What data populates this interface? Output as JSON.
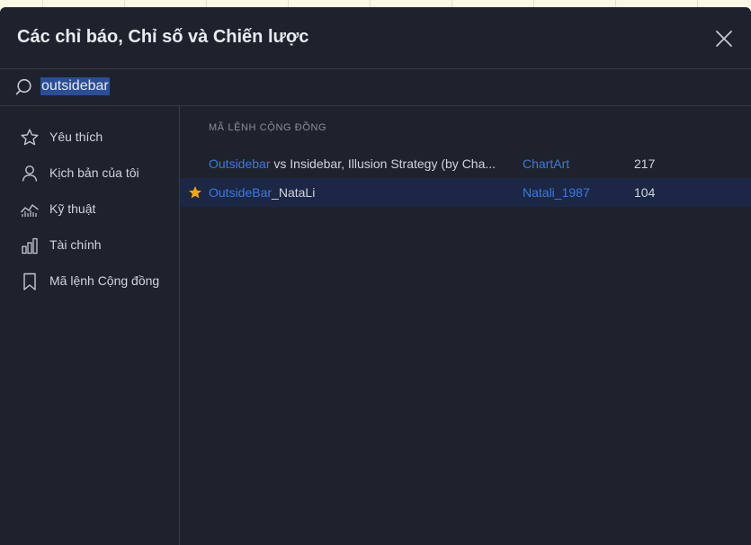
{
  "dialog": {
    "title": "Các chỉ báo, Chỉ số và Chiến lược"
  },
  "search": {
    "value": "outsidebar",
    "placeholder": "",
    "icon": "search-icon"
  },
  "sidebar": {
    "items": [
      {
        "label": "Yêu thích",
        "icon": "star-outline-icon"
      },
      {
        "label": "Kịch bản của tôi",
        "icon": "user-icon"
      },
      {
        "label": "Kỹ thuật",
        "icon": "chart-line-icon"
      },
      {
        "label": "Tài chính",
        "icon": "bar-chart-icon"
      },
      {
        "label": "Mã lệnh Cộng đồng",
        "icon": "bookmark-icon"
      }
    ]
  },
  "results": {
    "section_label": "MÃ LỆNH CỘNG ĐỒNG",
    "rows": [
      {
        "name_match": "Outsidebar",
        "name_rest": " vs Insidebar, Illusion Strategy (by Cha...",
        "author": "ChartArt",
        "count": "217",
        "favorite": false
      },
      {
        "name_match": "OutsideBar",
        "name_rest": "_NataLi",
        "author": "Natali_1987",
        "count": "104",
        "favorite": true
      }
    ]
  },
  "colors": {
    "dialog_bg": "#1e222d",
    "accent_blue": "#3d7ae0",
    "star_gold": "#f7a600",
    "row_highlight": "#1b2744",
    "selection_bg": "#2a4f98"
  }
}
